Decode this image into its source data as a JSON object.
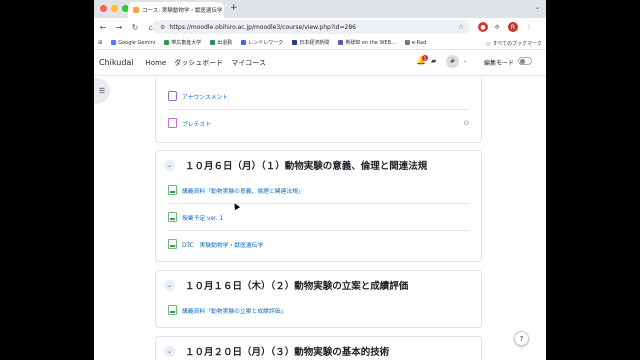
{
  "browser": {
    "tab_title": "コース: 実験動物学・獣医遺伝学",
    "new_tab": "+",
    "tab_close": "×",
    "url": "https://moodle.obihiro.ac.jp/moodle3/course/view.php?id=286",
    "profile_initial": "R",
    "bookmarks": [
      {
        "label": "Google Gemini",
        "color": "#4a7df0"
      },
      {
        "label": "帯広畜産大学",
        "color": "#2e9a4a"
      },
      {
        "label": "出退勤",
        "color": "#2e8b57"
      },
      {
        "label": "レンドレワーク",
        "color": "#3b6fd6"
      },
      {
        "label": "日本経済新聞",
        "color": "#1c3f7a"
      },
      {
        "label": "英辞郎 on the WEB...",
        "color": "#6b4fbb"
      },
      {
        "label": "e-Rad",
        "color": "#777777"
      }
    ],
    "all_bookmarks": "すべてのブックマーク"
  },
  "nav": {
    "brand": "Chikudai",
    "links": [
      "Home",
      "ダッシュボード",
      "マイコース"
    ],
    "notification_count": "1",
    "avatar": "#",
    "edit_mode": "編集モード"
  },
  "sections": [
    {
      "activities": [
        {
          "label": "アナウンスメント",
          "type": "forum"
        },
        {
          "label": "プレテスト",
          "type": "quiz"
        }
      ]
    },
    {
      "title": "１０月６日（月）（１）動物実験の意義、倫理と関連法規",
      "activities": [
        {
          "label": "講義資料「動物実験の意義、倫理と関連法規」",
          "type": "pdf"
        },
        {
          "label": "授業予定 ver. 1",
          "type": "pdf"
        },
        {
          "label": "DTC　実験動物学・獣医遺伝学",
          "type": "pdf"
        }
      ]
    },
    {
      "title": "１０月１６日（木）（２）動物実験の立案と成績評価",
      "activities": [
        {
          "label": "講義資料「動物実験の立案と成績評価」",
          "type": "pdf"
        }
      ]
    },
    {
      "title": "１０月２０日（月）（３）動物実験の基本的技術",
      "activities": []
    }
  ],
  "help": "?"
}
